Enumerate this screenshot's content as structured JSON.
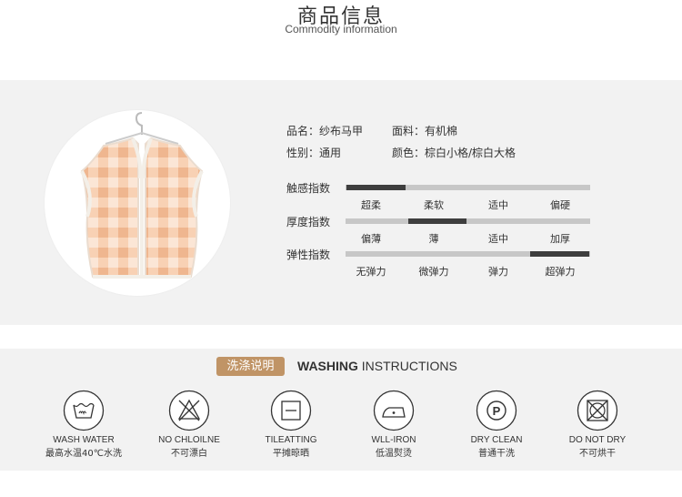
{
  "header": {
    "title_cn": "商品信息",
    "title_en": "Commodity information"
  },
  "product": {
    "image_icon": "vest-garment-icon",
    "name_label": "品名：",
    "name_value": "纱布马甲",
    "fabric_label": "面料：",
    "fabric_value": "有机棉",
    "gender_label": "性别：",
    "gender_value": "通用",
    "color_label": "颜色：",
    "color_value": "棕白小格/棕白大格"
  },
  "scales": [
    {
      "label": "触感指数",
      "options": [
        "超柔",
        "柔软",
        "适中",
        "偏硬"
      ],
      "selected_index": 0
    },
    {
      "label": "厚度指数",
      "options": [
        "偏薄",
        "薄",
        "适中",
        "加厚"
      ],
      "selected_index": 1
    },
    {
      "label": "弹性指数",
      "options": [
        "无弹力",
        "微弹力",
        "弹力",
        "超弹力"
      ],
      "selected_index": 3
    }
  ],
  "washing": {
    "badge": "洗涤说明",
    "title_bold": "WASHING",
    "title_rest": " INSTRUCTIONS",
    "items": [
      {
        "icon": "wash-water-icon",
        "en": "WASH WATER",
        "cn": "最高水温40℃水洗"
      },
      {
        "icon": "no-bleach-icon",
        "en": "NO CHLOILNE",
        "cn": "不可漂白"
      },
      {
        "icon": "flat-dry-icon",
        "en": "TILEATTING",
        "cn": "平摊晾晒"
      },
      {
        "icon": "low-iron-icon",
        "en": "WLL-IRON",
        "cn": "低温熨烫"
      },
      {
        "icon": "dry-clean-icon",
        "en": "DRY CLEAN",
        "cn": "普通干洗"
      },
      {
        "icon": "no-tumble-dry-icon",
        "en": "DO NOT DRY",
        "cn": "不可烘干"
      }
    ]
  },
  "colors": {
    "accent": "#c09466",
    "bar_track": "#c7c7c7",
    "bar_fill": "#3e3e3e",
    "band_bg": "#f2f2f2"
  }
}
